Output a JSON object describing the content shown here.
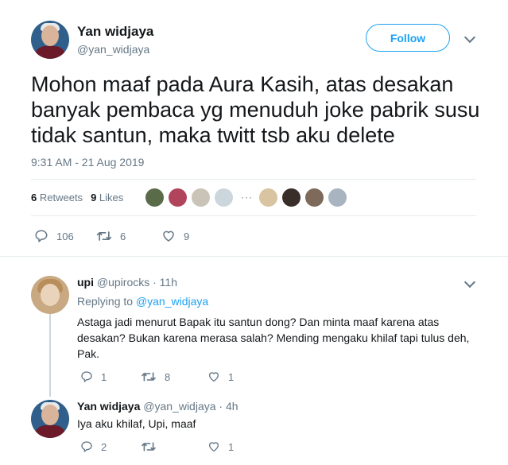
{
  "main_tweet": {
    "author_name": "Yan widjaya",
    "author_handle": "@yan_widjaya",
    "follow_label": "Follow",
    "text": "Mohon maaf pada Aura Kasih, atas desakan banyak pembaca yg menuduh joke pabrik susu tidak santun, maka twitt tsb aku delete",
    "timestamp": "9:31 AM - 21 Aug 2019",
    "retweets_count": "6",
    "retweets_label": "Retweets",
    "likes_count": "9",
    "likes_label": "Likes",
    "more_likers": "···",
    "actions": {
      "reply_count": "106",
      "retweet_count": "6",
      "like_count": "9"
    }
  },
  "replies": [
    {
      "author_name": "upi",
      "author_handle": "@upirocks",
      "time": "· 11h",
      "replying_prefix": "Replying to",
      "replying_to": "@yan_widjaya",
      "text": "Astaga jadi menurut Bapak itu santun dong? Dan minta maaf karena atas desakan? Bukan karena merasa salah? Mending mengaku khilaf tapi tulus deh, Pak.",
      "reply_count": "1",
      "retweet_count": "8",
      "like_count": "1"
    },
    {
      "author_name": "Yan widjaya",
      "author_handle": "@yan_widjaya",
      "time": "· 4h",
      "text": "Iya aku khilaf, Upi, maaf",
      "reply_count": "2",
      "like_count": "1"
    }
  ],
  "colors": {
    "accent": "#1da1f2",
    "secondary_text": "#657786",
    "primary_text": "#14171a",
    "divider": "#e6ecf0"
  },
  "icons": [
    "reply-icon",
    "retweet-icon",
    "like-icon",
    "chevron-down-icon"
  ]
}
